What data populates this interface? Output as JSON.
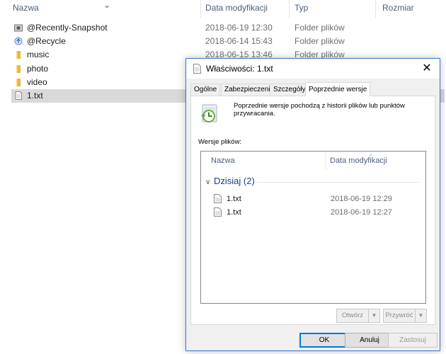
{
  "explorer": {
    "columns": {
      "name": "Nazwa",
      "modified": "Data modyfikacji",
      "type": "Typ",
      "size": "Rozmiar"
    },
    "files": [
      {
        "name": "@Recently-Snapshot",
        "date": "2018-06-19 12:30",
        "type": "Folder plików",
        "icon": "snapshot-folder-icon"
      },
      {
        "name": "@Recycle",
        "date": "2018-06-14 15:43",
        "type": "Folder plików",
        "icon": "recycle-folder-icon"
      },
      {
        "name": "music",
        "date": "2018-06-15 13:46",
        "type": "Folder plików",
        "icon": "folder-icon"
      },
      {
        "name": "photo",
        "date": "",
        "type": "",
        "icon": "folder-icon"
      },
      {
        "name": "video",
        "date": "",
        "type": "",
        "icon": "folder-icon"
      },
      {
        "name": "1.txt",
        "date": "",
        "type": "",
        "icon": "text-file-icon",
        "selected": true
      }
    ]
  },
  "dialog": {
    "title": "Właściwości: 1.txt",
    "close_symbol": "✕",
    "tabs": [
      "Ogólne",
      "Zabezpieczenia",
      "Szczegóły",
      "Poprzednie wersje"
    ],
    "active_tab": "Poprzednie wersje",
    "description": "Poprzednie wersje pochodzą z historii plików lub punktów przywracania.",
    "versions_label": "Wersje plików:",
    "list_columns": {
      "name": "Nazwa",
      "modified": "Data modyfikacji"
    },
    "group": {
      "label": "Dzisiaj (2)"
    },
    "versions": [
      {
        "name": "1.txt",
        "date": "2018-06-19 12:29"
      },
      {
        "name": "1.txt",
        "date": "2018-06-19 12:27"
      }
    ],
    "open_label": "Otwórz",
    "restore_label": "Przywróć",
    "ok_label": "OK",
    "cancel_label": "Anuluj",
    "apply_label": "Zastosuj"
  },
  "colors": {
    "accent": "#0078d7",
    "selection": "#d9d9d9",
    "folder": "#e8b440",
    "group_text": "#1e3e8c"
  }
}
